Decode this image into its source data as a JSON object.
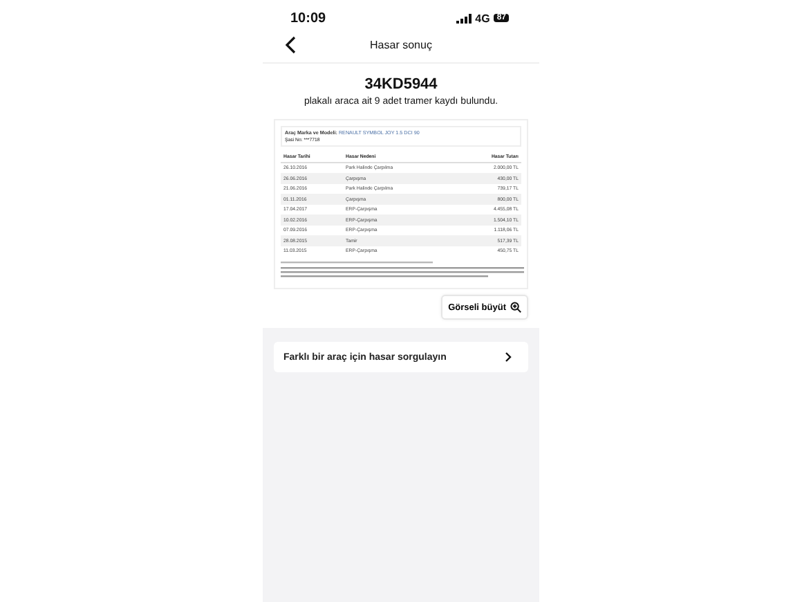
{
  "status_bar": {
    "time": "10:09",
    "network": "4G",
    "battery": "87"
  },
  "nav": {
    "title": "Hasar sonuç"
  },
  "result": {
    "plate": "34KD5944",
    "summary": "plakalı araca ait 9 adet tramer kaydı bulundu."
  },
  "report": {
    "model_label": "Araç Marka ve Modeli:",
    "model": "RENAULT SYMBOL JOY 1.5 DCI 90",
    "chassis": "Şasi No: ***7718",
    "columns": [
      "Hasar Tarihi",
      "Hasar Nedeni",
      "Hasar Tutarı"
    ],
    "rows": [
      [
        "26.10.2016",
        "Park Halinde Çarpılma",
        "2.000,00 TL"
      ],
      [
        "26.06.2016",
        "Çarpışma",
        "430,00 TL"
      ],
      [
        "21.06.2016",
        "Park Halinde Çarpılma",
        "739,17 TL"
      ],
      [
        "01.11.2016",
        "Çarpışma",
        "800,00 TL"
      ],
      [
        "17.04.2017",
        "ERP-Çarpışma",
        "4.455,08 TL"
      ],
      [
        "10.02.2016",
        "ERP-Çarpışma",
        "1.504,10 TL"
      ],
      [
        "07.09.2016",
        "ERP-Çarpışma",
        "1.118,06 TL"
      ],
      [
        "28.08.2015",
        "Tamir",
        "517,39 TL"
      ],
      [
        "11.03.2015",
        "ERP-Çarpışma",
        "450,75 TL"
      ]
    ]
  },
  "enlarge_button": "Görseli büyüt",
  "query_link": "Farklı bir araç için hasar sorgulayın"
}
